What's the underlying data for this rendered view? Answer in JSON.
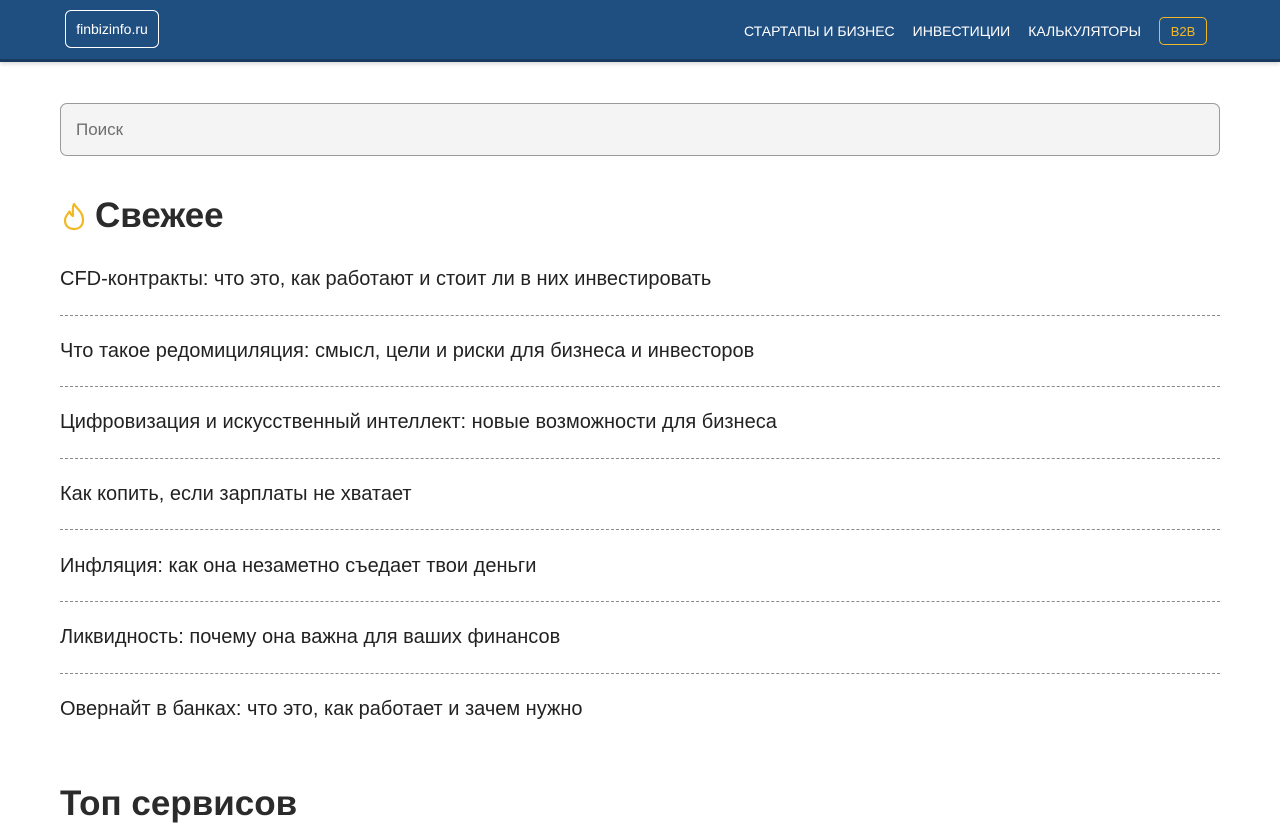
{
  "header": {
    "logo": "finbizinfo.ru",
    "nav": [
      {
        "label": "СТАРТАПЫ И БИЗНЕС"
      },
      {
        "label": "ИНВЕСТИЦИИ"
      },
      {
        "label": "КАЛЬКУЛЯТОРЫ"
      }
    ],
    "b2b_label": "B2B"
  },
  "search": {
    "placeholder": "Поиск",
    "value": ""
  },
  "fresh": {
    "icon": "flame-icon",
    "title": "Свежее",
    "articles": [
      {
        "title": "CFD-контракты: что это, как работают и стоит ли в них инвестировать"
      },
      {
        "title": "Что такое редомициляция: смысл, цели и риски для бизнеса и инвесторов"
      },
      {
        "title": "Цифровизация и искусственный интеллект: новые возможности для бизнеса"
      },
      {
        "title": "Как копить, если зарплаты не хватает"
      },
      {
        "title": "Инфляция: как она незаметно съедает твои деньги"
      },
      {
        "title": "Ликвидность: почему она важна для ваших финансов"
      },
      {
        "title": "Овернайт в банках: что это, как работает и зачем нужно"
      }
    ]
  },
  "top_services": {
    "title": "Топ сервисов"
  },
  "colors": {
    "header_bg": "#1f4e80",
    "accent": "#f2b824",
    "text": "#222222",
    "divider": "#8a8a8a"
  }
}
